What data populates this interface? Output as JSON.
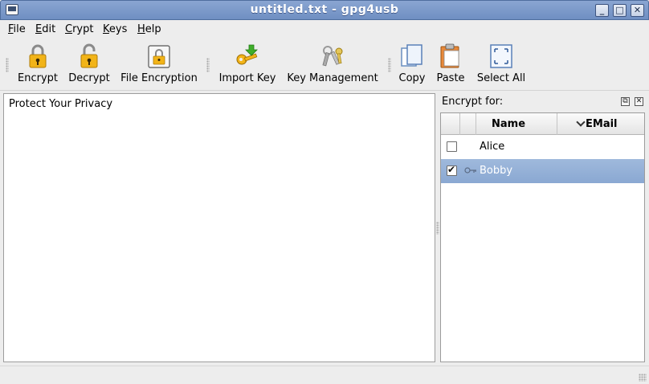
{
  "window": {
    "title": "untitled.txt - gpg4usb"
  },
  "menubar": {
    "items": [
      {
        "accel": "F",
        "rest": "ile"
      },
      {
        "accel": "E",
        "rest": "dit"
      },
      {
        "accel": "C",
        "rest": "rypt"
      },
      {
        "accel": "K",
        "rest": "eys"
      },
      {
        "accel": "H",
        "rest": "elp"
      }
    ]
  },
  "toolbar": {
    "encrypt": {
      "label": "Encrypt",
      "icon": "lock-closed-icon"
    },
    "decrypt": {
      "label": "Decrypt",
      "icon": "lock-open-icon"
    },
    "file_encryption": {
      "label": "File Encryption",
      "icon": "file-lock-icon"
    },
    "import_key": {
      "label": "Import Key",
      "icon": "key-import-icon"
    },
    "key_management": {
      "label": "Key Management",
      "icon": "keyring-icon"
    },
    "copy": {
      "label": "Copy",
      "icon": "copy-icon"
    },
    "paste": {
      "label": "Paste",
      "icon": "paste-icon"
    },
    "select_all": {
      "label": "Select All",
      "icon": "select-all-icon"
    }
  },
  "editor": {
    "content": "Protect Your Privacy"
  },
  "dock": {
    "title": "Encrypt for:",
    "columns": {
      "name": "Name",
      "email": "EMail"
    },
    "keys": [
      {
        "name": "Alice",
        "checked": false,
        "selected": false
      },
      {
        "name": "Bobby",
        "checked": true,
        "selected": true
      }
    ]
  },
  "colors": {
    "titlebar": "#7a98c9",
    "selection": "#94b0d7"
  }
}
